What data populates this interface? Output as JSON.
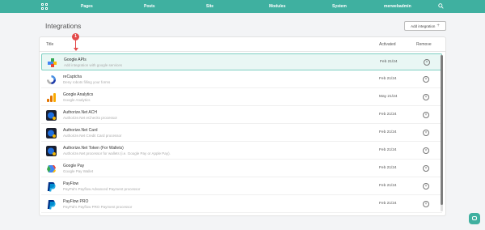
{
  "nav": {
    "items": [
      {
        "label": "Pages"
      },
      {
        "label": "Posts"
      },
      {
        "label": "Site"
      },
      {
        "label": "Modules"
      },
      {
        "label": "System"
      },
      {
        "label": "merwebadmin"
      }
    ]
  },
  "page": {
    "title": "Integrations",
    "add_button": "Add integration"
  },
  "table": {
    "columns": {
      "title": "Title",
      "activated": "Activated",
      "remove": "Remove"
    },
    "rows": [
      {
        "name": "Google APIs",
        "desc": "Add integration with google services",
        "date": "Feb 21/24",
        "logo": "google-apis-logo"
      },
      {
        "name": "reCaptcha",
        "desc": "Deny robots filling your forms",
        "date": "Feb 21/24",
        "logo": "recaptcha-logo"
      },
      {
        "name": "Google Analytics",
        "desc": "Google Analytics",
        "date": "May 21/24",
        "logo": "google-analytics-logo"
      },
      {
        "name": "Authorize.Net ACH",
        "desc": "Authorize.Net eChecks processor",
        "date": "Feb 21/24",
        "logo": "authorize-net-logo"
      },
      {
        "name": "Authorize.Net Card",
        "desc": "Authorize.Net Credit Card processor",
        "date": "Feb 21/24",
        "logo": "authorize-net-logo"
      },
      {
        "name": "Authorize.Net Token (For Wallets)",
        "desc": "Authorize.Net processor for wallets (i.e. Google Pay or Apple Pay).",
        "date": "Feb 21/24",
        "logo": "authorize-net-logo"
      },
      {
        "name": "Google Pay",
        "desc": "Google Pay Wallet",
        "date": "Feb 21/24",
        "logo": "google-pay-logo"
      },
      {
        "name": "PayFlow",
        "desc": "PayPal's Payflow Advanced Payment processor",
        "date": "Feb 21/24",
        "logo": "paypal-logo"
      },
      {
        "name": "PayFlow PRO",
        "desc": "PayPal's Payflow PRO Payment processor",
        "date": "Feb 21/24",
        "logo": "paypal-logo"
      }
    ]
  },
  "annotation": {
    "badge": "1"
  },
  "colors": {
    "accent": "#3fb0a0",
    "highlight": "#e9f7f4",
    "badge": "#e34b4b"
  }
}
